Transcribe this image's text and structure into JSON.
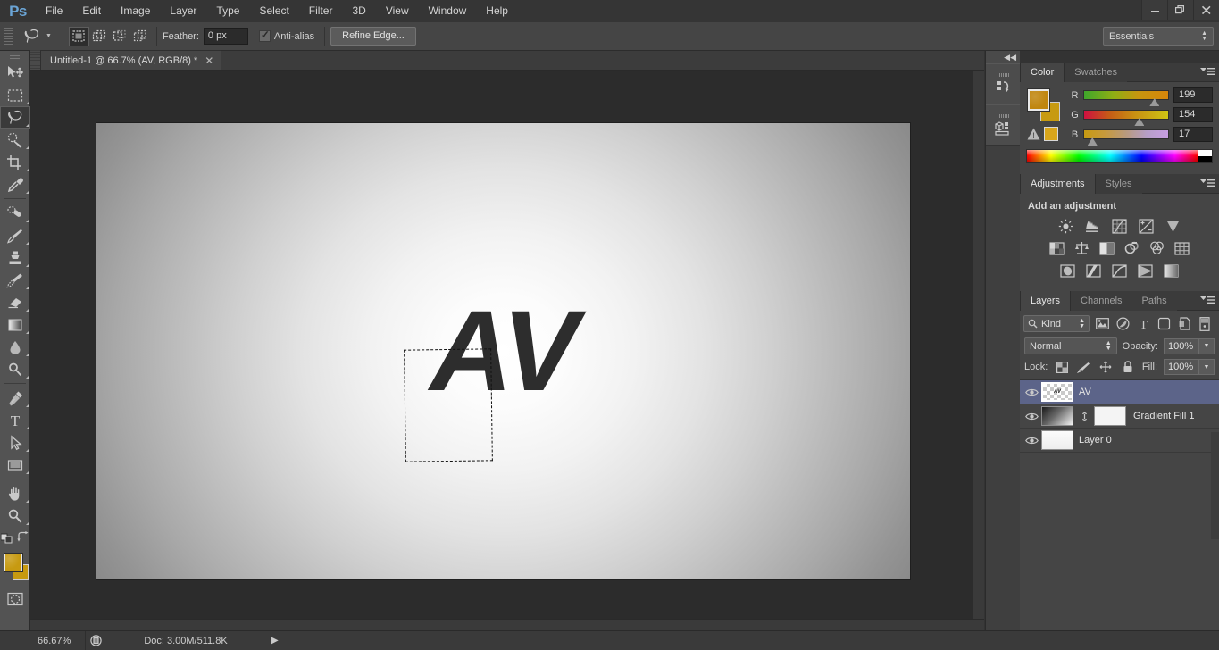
{
  "app": {
    "logo": "Ps",
    "menus": [
      "File",
      "Edit",
      "Image",
      "Layer",
      "Type",
      "Select",
      "Filter",
      "3D",
      "View",
      "Window",
      "Help"
    ],
    "window_controls": [
      {
        "name": "minimize",
        "glyph": "–"
      },
      {
        "name": "restore",
        "glyph": "❐"
      },
      {
        "name": "close",
        "glyph": "✕"
      }
    ]
  },
  "options_bar": {
    "tool_preset_icon": "lasso-tool-icon",
    "selection_modes": [
      "new-selection",
      "add-to-selection",
      "subtract-from-selection",
      "intersect-with-selection"
    ],
    "active_selection_mode": 0,
    "feather_label": "Feather:",
    "feather_value": "0 px",
    "antialias_label": "Anti-alias",
    "antialias_checked": true,
    "refine_edge_label": "Refine Edge...",
    "workspace": "Essentials"
  },
  "toolbar": {
    "tools": [
      {
        "name": "move-tool",
        "has_corner": false,
        "active": false
      },
      {
        "name": "rectangular-marquee-tool",
        "has_corner": true,
        "active": false
      },
      {
        "name": "lasso-tool",
        "has_corner": true,
        "active": true
      },
      {
        "name": "quick-selection-tool",
        "has_corner": true,
        "active": false
      },
      {
        "name": "crop-tool",
        "has_corner": true,
        "active": false
      },
      {
        "name": "eyedropper-tool",
        "has_corner": true,
        "active": false
      },
      {
        "name": "spot-healing-brush-tool",
        "has_corner": true,
        "active": false
      },
      {
        "name": "brush-tool",
        "has_corner": true,
        "active": false
      },
      {
        "name": "clone-stamp-tool",
        "has_corner": true,
        "active": false
      },
      {
        "name": "history-brush-tool",
        "has_corner": true,
        "active": false
      },
      {
        "name": "eraser-tool",
        "has_corner": true,
        "active": false
      },
      {
        "name": "gradient-tool",
        "has_corner": true,
        "active": false
      },
      {
        "name": "blur-tool",
        "has_corner": true,
        "active": false
      },
      {
        "name": "dodge-tool",
        "has_corner": true,
        "active": false
      },
      {
        "name": "pen-tool",
        "has_corner": true,
        "active": false
      },
      {
        "name": "horizontal-type-tool",
        "has_corner": true,
        "active": false
      },
      {
        "name": "path-selection-tool",
        "has_corner": true,
        "active": false
      },
      {
        "name": "rectangle-tool",
        "has_corner": true,
        "active": false
      },
      {
        "name": "hand-tool",
        "has_corner": true,
        "active": false
      },
      {
        "name": "zoom-tool",
        "has_corner": true,
        "active": false
      }
    ],
    "default_colors_label": "default-colors-icon",
    "swap_colors_label": "swap-colors-icon",
    "foreground_color": "#c0860f",
    "background_color": "#c79a11",
    "quick_mask_label": "quick-mask-mode-icon"
  },
  "document": {
    "tab_title": "Untitled-1 @ 66.7% (AV, RGB/8) *",
    "tab_close": "✕",
    "canvas_text": "AV",
    "selection": "lasso-selection-marquee"
  },
  "status_bar": {
    "zoom": "66.67%",
    "doc_icon": "document-info-icon",
    "doc_info": "Doc: 3.00M/511.8K",
    "expand_arrow": "▶"
  },
  "mini_dock": {
    "collapse_glyph": "◀◀",
    "buttons": [
      {
        "name": "history-panel-icon"
      },
      {
        "name": "mini-bridge-panel-icon"
      }
    ]
  },
  "color_panel": {
    "tabs": [
      "Color",
      "Swatches"
    ],
    "active_tab": "Color",
    "menu_glyph": "☰",
    "foreground_color": "#c0860f",
    "background_color": "#c79a11",
    "gamut_warning_icon": "out-of-gamut-warning-icon",
    "gamut_swatch_color": "#d8a51b",
    "channels": [
      {
        "label": "R",
        "value": "199",
        "pos": 78
      },
      {
        "label": "G",
        "value": "154",
        "pos": 60
      },
      {
        "label": "B",
        "value": "17",
        "pos": 4
      }
    ]
  },
  "adjustments_panel": {
    "tabs": [
      "Adjustments",
      "Styles"
    ],
    "active_tab": "Adjustments",
    "menu_glyph": "☰",
    "heading": "Add an adjustment",
    "rows": [
      [
        "brightness-contrast-icon",
        "levels-icon",
        "curves-icon",
        "exposure-icon",
        "vibrance-icon"
      ],
      [
        "hue-saturation-icon",
        "color-balance-icon",
        "black-white-icon",
        "photo-filter-icon",
        "channel-mixer-icon",
        "color-lookup-icon"
      ],
      [
        "invert-icon",
        "posterize-icon",
        "threshold-icon",
        "gradient-map-icon",
        "selective-color-icon"
      ]
    ]
  },
  "layers_panel": {
    "tabs": [
      "Layers",
      "Channels",
      "Paths"
    ],
    "active_tab": "Layers",
    "menu_glyph": "☰",
    "filter": {
      "kind_label": "Kind",
      "search_icon": "search-icon",
      "filter_icons": [
        "filter-pixel-layers-icon",
        "filter-adjustment-layers-icon",
        "filter-type-layers-icon",
        "filter-shape-layers-icon",
        "filter-smart-objects-icon",
        "filter-toggle-icon"
      ]
    },
    "blend_mode": "Normal",
    "opacity_label": "Opacity:",
    "opacity_value": "100%",
    "lock_label": "Lock:",
    "lock_icons": [
      "lock-transparent-pixels-icon",
      "lock-image-pixels-icon",
      "lock-position-icon",
      "lock-all-icon"
    ],
    "fill_label": "Fill:",
    "fill_value": "100%",
    "layers": [
      {
        "name": "AV",
        "selected": true,
        "thumb": "checker",
        "has_mask": false,
        "visible": true
      },
      {
        "name": "Gradient Fill 1",
        "selected": false,
        "thumb": "gradient",
        "has_mask": true,
        "visible": true
      },
      {
        "name": "Layer 0",
        "selected": false,
        "thumb": "layer0",
        "has_mask": false,
        "visible": true
      }
    ],
    "footer_icons": [
      "link-layers-icon",
      "layer-style-fx-icon",
      "add-layer-mask-icon",
      "new-adjustment-layer-icon",
      "new-group-icon",
      "new-layer-icon",
      "delete-layer-icon"
    ]
  }
}
